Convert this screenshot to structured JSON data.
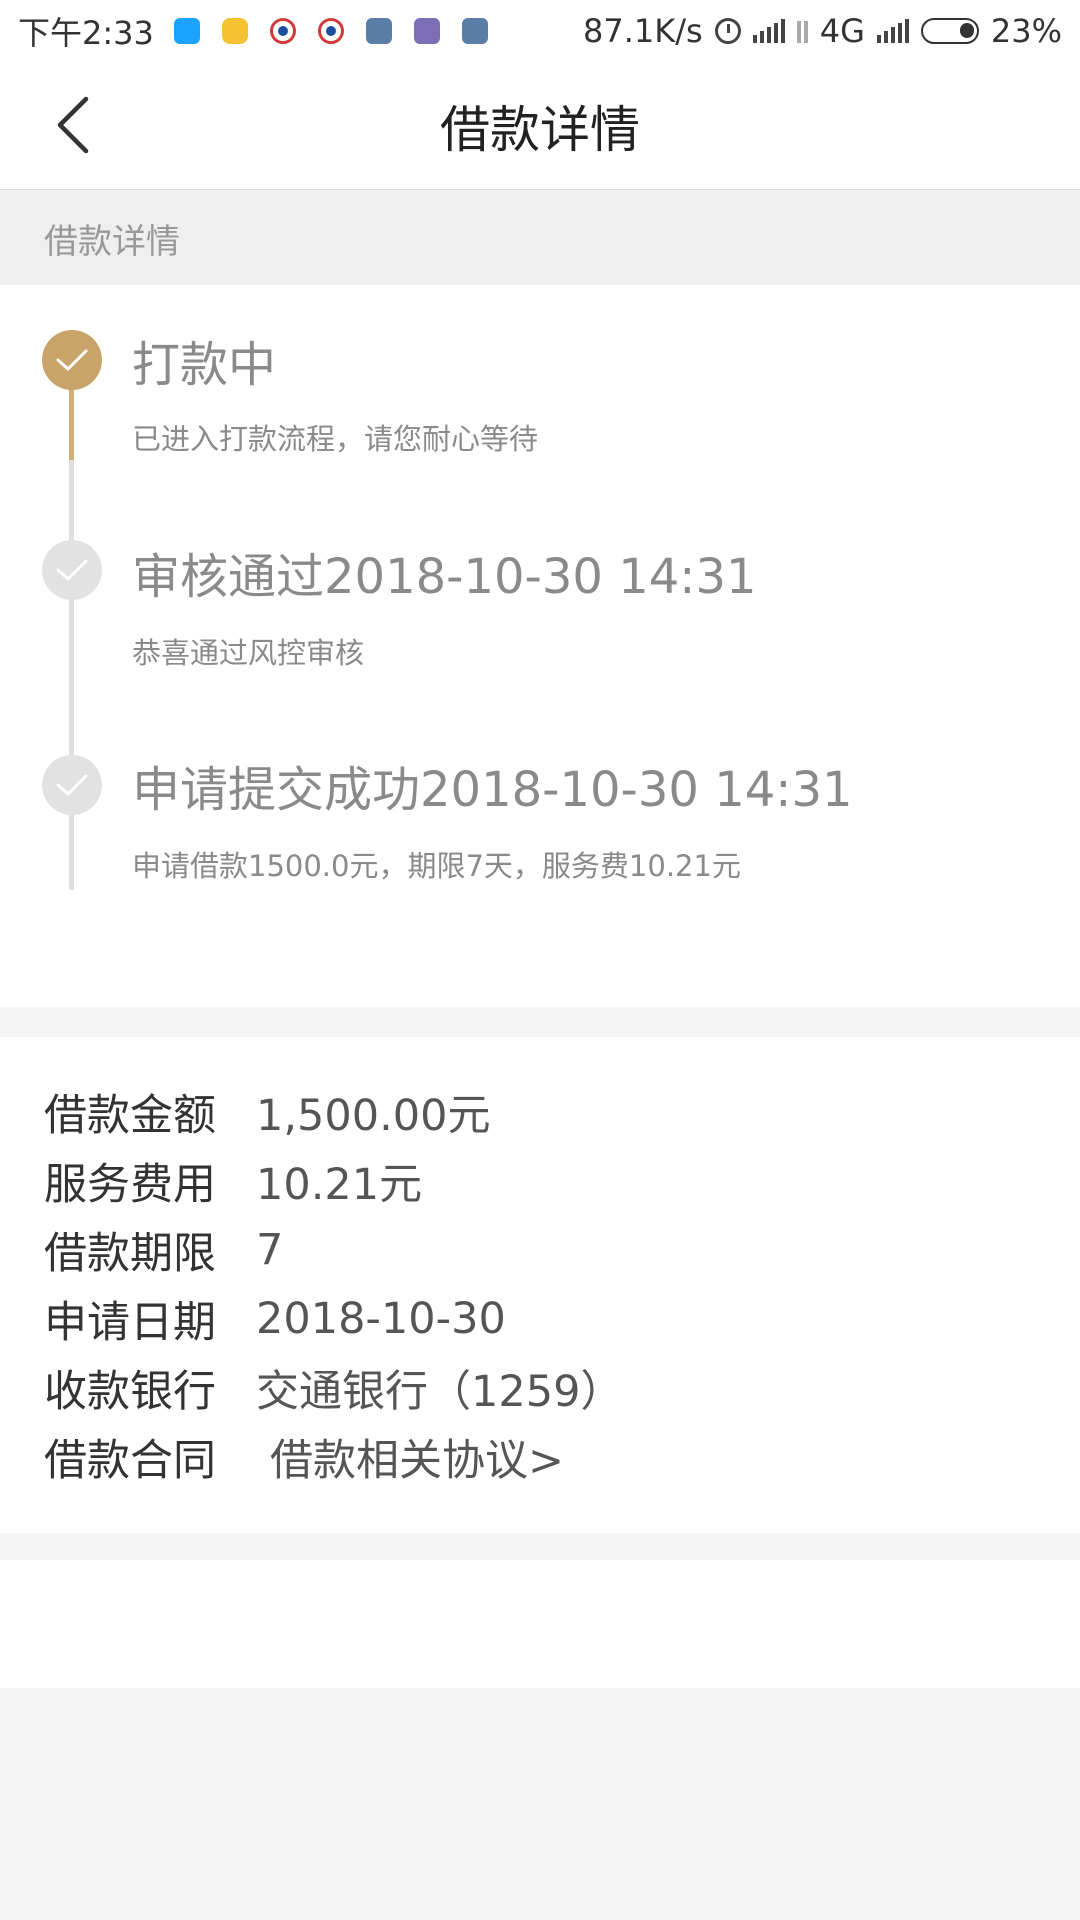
{
  "status_bar": {
    "time": "下午2:33",
    "net_speed": "87.1K/s",
    "network_type": "4G",
    "battery": "23%",
    "icons": [
      "qq-icon",
      "message-icon",
      "app-icon",
      "app-icon",
      "gallery-icon",
      "gallery-icon",
      "gallery-icon",
      "alarm-icon",
      "signal-icon",
      "data-arrows-icon",
      "signal-icon",
      "battery-icon"
    ]
  },
  "nav": {
    "title": "借款详情",
    "back_icon": "chevron-left-icon"
  },
  "section_header": "借款详情",
  "timeline": [
    {
      "title": "打款中",
      "desc": "已进入打款流程，请您耐心等待",
      "status": "current",
      "color": "#c9a46a"
    },
    {
      "title": "审核通过2018-10-30 14:31",
      "desc": "恭喜通过风控审核",
      "status": "done",
      "color": "#e2e2e2"
    },
    {
      "title": "申请提交成功2018-10-30 14:31",
      "desc": "申请借款1500.0元，期限7天，服务费10.21元",
      "status": "done",
      "color": "#e2e2e2"
    }
  ],
  "details": [
    {
      "label": "借款金额",
      "value": "1,500.00元"
    },
    {
      "label": "服务费用",
      "value": "10.21元"
    },
    {
      "label": "借款期限",
      "value": "7"
    },
    {
      "label": "申请日期",
      "value": "2018-10-30"
    },
    {
      "label": "收款银行",
      "value": "交通银行（1259）"
    }
  ],
  "contract": {
    "label": "借款合同",
    "link": "借款相关协议>"
  },
  "colors": {
    "accent_gold": "#c9a46a",
    "line_gold": "#d1ae72",
    "inactive_grey": "#e2e2e2",
    "page_bg": "#f5f5f5"
  }
}
